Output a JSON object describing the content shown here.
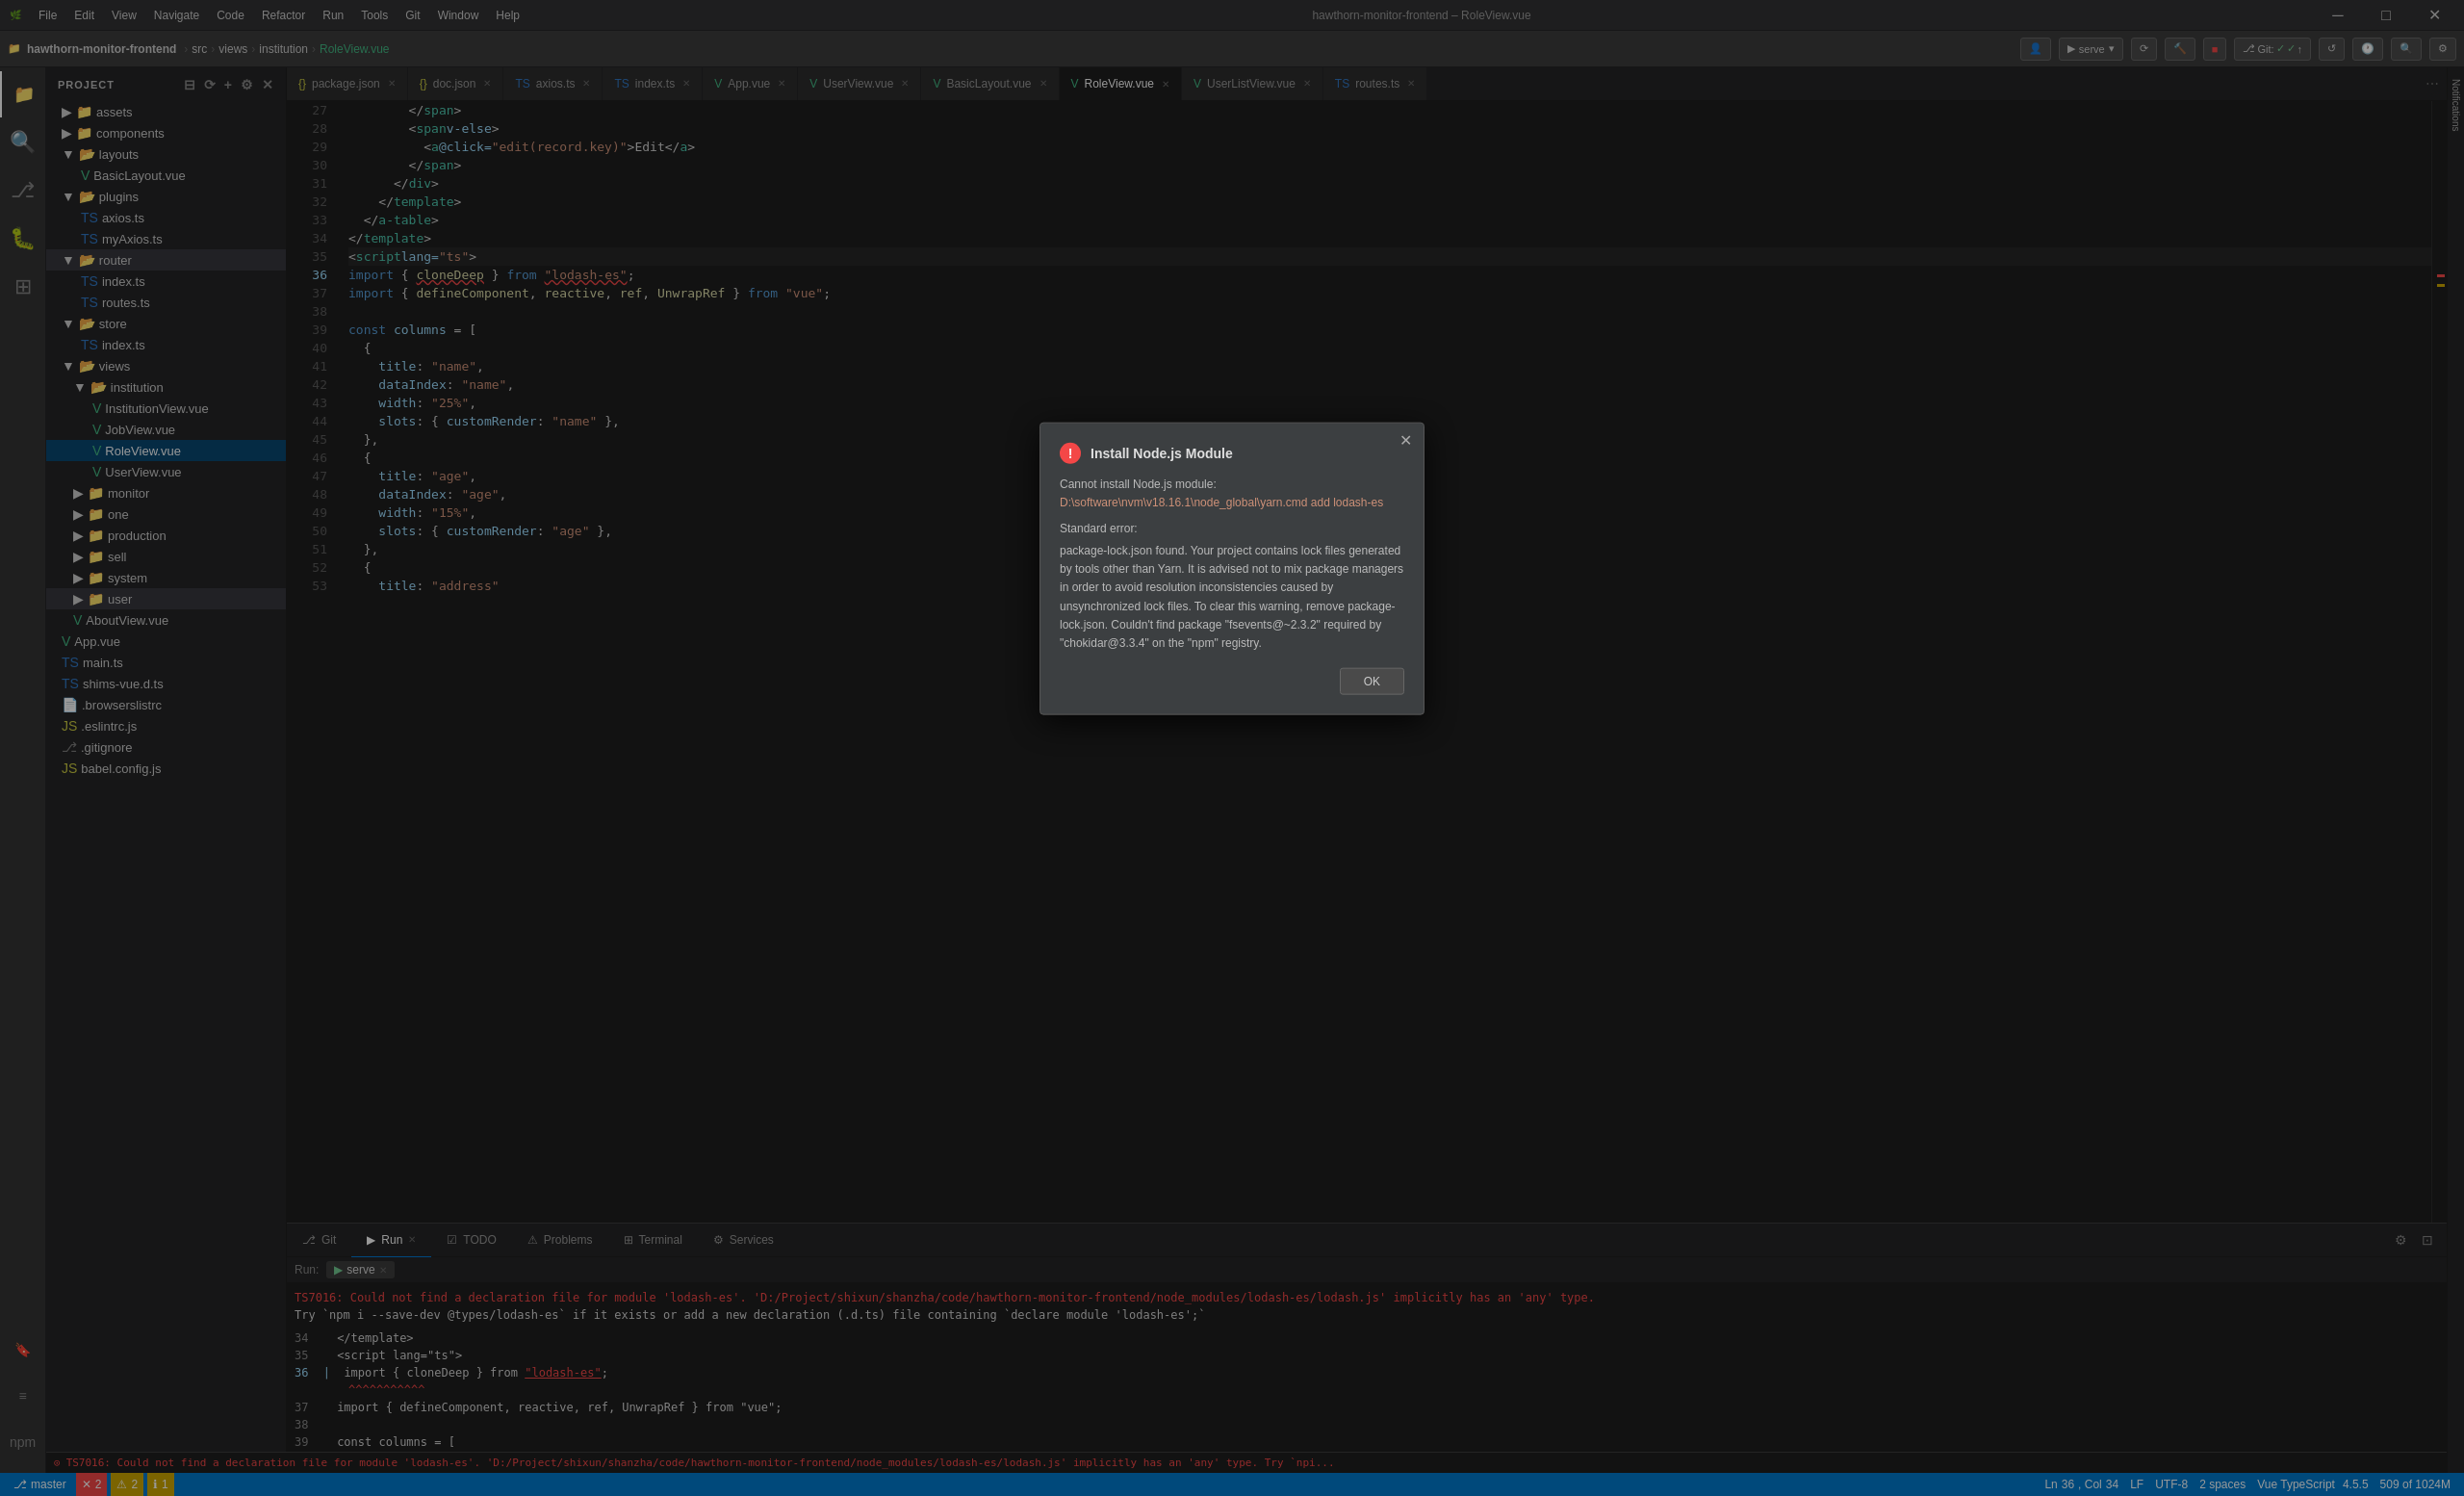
{
  "titleBar": {
    "appName": "hawthorn-monitor-frontend",
    "fileName": "RoleView.vue",
    "title": "hawthorn-monitor-frontend – RoleView.vue",
    "menu": [
      "File",
      "Edit",
      "View",
      "Navigate",
      "Code",
      "Refactor",
      "Run",
      "Tools",
      "Git",
      "Window",
      "Help"
    ]
  },
  "breadcrumb": {
    "items": [
      "hawthorn-monitor-frontend",
      "src",
      "views",
      "institution",
      "RoleView.vue"
    ]
  },
  "toolbar": {
    "profileIcon": "👤",
    "serveLabel": "serve",
    "gitLabel": "Git:",
    "runIcon": "▶"
  },
  "sidebar": {
    "header": "Project",
    "tree": [
      {
        "id": "assets",
        "label": "assets",
        "type": "folder",
        "level": 2
      },
      {
        "id": "components",
        "label": "components",
        "type": "folder",
        "level": 2
      },
      {
        "id": "layouts",
        "label": "layouts",
        "type": "folder",
        "level": 2
      },
      {
        "id": "BasicLayout.vue",
        "label": "BasicLayout.vue",
        "type": "vue",
        "level": 3
      },
      {
        "id": "plugins",
        "label": "plugins",
        "type": "folder",
        "level": 2
      },
      {
        "id": "axios.ts",
        "label": "axios.ts",
        "type": "ts",
        "level": 3
      },
      {
        "id": "myAxios.ts",
        "label": "myAxios.ts",
        "type": "ts",
        "level": 3
      },
      {
        "id": "router",
        "label": "router",
        "type": "folder",
        "level": 2
      },
      {
        "id": "index-router.ts",
        "label": "index.ts",
        "type": "ts",
        "level": 3
      },
      {
        "id": "routes.ts",
        "label": "routes.ts",
        "type": "ts",
        "level": 3
      },
      {
        "id": "store",
        "label": "store",
        "type": "folder",
        "level": 2
      },
      {
        "id": "index-store.ts",
        "label": "index.ts",
        "type": "ts",
        "level": 3
      },
      {
        "id": "views",
        "label": "views",
        "type": "folder",
        "level": 2
      },
      {
        "id": "institution",
        "label": "institution",
        "type": "folder",
        "level": 3
      },
      {
        "id": "InstitutionView.vue",
        "label": "InstitutionView.vue",
        "type": "vue",
        "level": 4
      },
      {
        "id": "JobView.vue",
        "label": "JobView.vue",
        "type": "vue",
        "level": 4
      },
      {
        "id": "RoleView.vue",
        "label": "RoleView.vue",
        "type": "vue",
        "level": 4,
        "active": true
      },
      {
        "id": "UserView.vue-inst",
        "label": "UserView.vue",
        "type": "vue",
        "level": 4
      },
      {
        "id": "monitor",
        "label": "monitor",
        "type": "folder",
        "level": 3
      },
      {
        "id": "one",
        "label": "one",
        "type": "folder",
        "level": 3
      },
      {
        "id": "production",
        "label": "production",
        "type": "folder",
        "level": 3
      },
      {
        "id": "sell",
        "label": "sell",
        "type": "folder",
        "level": 3
      },
      {
        "id": "system",
        "label": "system",
        "type": "folder",
        "level": 3
      },
      {
        "id": "user",
        "label": "user",
        "type": "folder",
        "level": 3
      },
      {
        "id": "AboutView.vue",
        "label": "AboutView.vue",
        "type": "vue",
        "level": 3
      },
      {
        "id": "App.vue",
        "label": "App.vue",
        "type": "vue",
        "level": 2
      },
      {
        "id": "main.ts",
        "label": "main.ts",
        "type": "ts",
        "level": 2
      },
      {
        "id": "shims-vue.d.ts",
        "label": "shims-vue.d.ts",
        "type": "ts",
        "level": 2
      },
      {
        "id": "browserslistrc",
        "label": ".browserslistrc",
        "type": "file",
        "level": 2
      },
      {
        "id": "eslintrc.js",
        "label": ".eslintrc.js",
        "type": "js",
        "level": 2
      },
      {
        "id": "gitignore",
        "label": ".gitignore",
        "type": "git",
        "level": 2
      },
      {
        "id": "babel.config.js",
        "label": "babel.config.js",
        "type": "js",
        "level": 2
      }
    ]
  },
  "tabs": [
    {
      "id": "package.json",
      "label": "package.json",
      "type": "json",
      "modified": false
    },
    {
      "id": "doc.json",
      "label": "doc.json",
      "type": "json",
      "modified": false
    },
    {
      "id": "axios.ts",
      "label": "axios.ts",
      "type": "ts",
      "modified": false
    },
    {
      "id": "index.ts",
      "label": "index.ts",
      "type": "ts",
      "modified": false
    },
    {
      "id": "App.vue",
      "label": "App.vue",
      "type": "vue",
      "modified": false
    },
    {
      "id": "UserView.vue",
      "label": "UserView.vue",
      "type": "vue",
      "modified": false
    },
    {
      "id": "BasicLayout.vue",
      "label": "BasicLayout.vue",
      "type": "vue",
      "modified": false
    },
    {
      "id": "RoleView.vue",
      "label": "RoleView.vue",
      "type": "vue",
      "active": true,
      "modified": false
    },
    {
      "id": "UserListView.vue",
      "label": "UserListView.vue",
      "type": "vue",
      "modified": false
    },
    {
      "id": "routes.ts",
      "label": "routes.ts",
      "type": "ts",
      "modified": false
    }
  ],
  "editor": {
    "lines": [
      {
        "num": 27,
        "code": "        </span>"
      },
      {
        "num": 28,
        "code": "        <span v-else>"
      },
      {
        "num": 29,
        "code": "          <a @click=\"edit(record.key)\">Edit</a>"
      },
      {
        "num": 30,
        "code": "        </span>"
      },
      {
        "num": 31,
        "code": "      </div>"
      },
      {
        "num": 32,
        "code": "    </template>"
      },
      {
        "num": 33,
        "code": "  </a-table>"
      },
      {
        "num": 34,
        "code": "</template>"
      },
      {
        "num": 35,
        "code": "<script lang=\"ts\">"
      },
      {
        "num": 36,
        "code": "import { cloneDeep } from \"lodash-es\";"
      },
      {
        "num": 37,
        "code": "import { defineComponent, reactive, ref, UnwrapRef } from \"vue\";"
      },
      {
        "num": 38,
        "code": ""
      },
      {
        "num": 39,
        "code": "const columns = ["
      },
      {
        "num": 40,
        "code": "  {"
      },
      {
        "num": 41,
        "code": "    title: \"name\","
      },
      {
        "num": 42,
        "code": "    dataIndex: \"name\","
      },
      {
        "num": 43,
        "code": "    width: \"25%\","
      },
      {
        "num": 44,
        "code": "    slots: { customRender: \"name\" },"
      },
      {
        "num": 45,
        "code": "  },"
      },
      {
        "num": 46,
        "code": "  {"
      },
      {
        "num": 47,
        "code": "    title: \"age\","
      },
      {
        "num": 48,
        "code": "    dataIndex: \"age\","
      },
      {
        "num": 49,
        "code": "    width: \"15%\","
      },
      {
        "num": 50,
        "code": "    slots: { customRender: \"age\" },"
      },
      {
        "num": 51,
        "code": "  },"
      },
      {
        "num": 52,
        "code": "  {"
      },
      {
        "num": 53,
        "code": "    title: \"address\""
      }
    ]
  },
  "modal": {
    "title": "Install Node.js Module",
    "errorIcon": "!",
    "body1": "Cannot install Node.js module:",
    "body2": "D:\\software\\nvm\\v18.16.1\\node_global\\yarn.cmd add lodash-es",
    "body3": "",
    "body4": "Standard error:",
    "body5": "package-lock.json found. Your project contains lock files generated by tools other than Yarn. It is advised not to mix package managers in order to avoid resolution inconsistencies caused by unsynchronized lock files. To clear this warning, remove package-lock.json. Couldn't find package \"fsevents@~2.3.2\" required by \"chokidar@3.3.4\" on the \"npm\" registry.",
    "okLabel": "OK"
  },
  "terminal": {
    "runLabel": "Run:",
    "serveLabel": "serve",
    "tabs": [
      {
        "id": "git",
        "label": "Git",
        "icon": "⎇"
      },
      {
        "id": "run",
        "label": "Run",
        "icon": "▶",
        "active": true
      },
      {
        "id": "todo",
        "label": "TODO",
        "icon": "☑"
      },
      {
        "id": "problems",
        "label": "Problems",
        "icon": "⚠"
      },
      {
        "id": "terminal",
        "label": "Terminal",
        "icon": "⊞"
      },
      {
        "id": "services",
        "label": "Services",
        "icon": "⚙"
      }
    ],
    "errorLine1": "TS7016: Could not find a declaration file for module 'lodash-es'. 'D:/Project/shixun/shanzha/code/hawthorn-monitor-frontend/node_modules/lodash-es/lodash.js' implicitly has an 'any' type.",
    "errorLine2": "Try `npm i --save-dev @types/lodash-es` if it exists or add a new declaration (.d.ts) file containing `declare module 'lodash-es';`",
    "codeLines": [
      {
        "num": "34",
        "code": "  </template>"
      },
      {
        "num": "35",
        "code": "  <script lang=\"ts\">"
      },
      {
        "num": "36",
        "code": "  import { cloneDeep } from \"lodash-es\";",
        "hasError": true
      },
      {
        "num": "",
        "code": "                             ^^^^^^^^^^^"
      },
      {
        "num": "37",
        "code": "  import { defineComponent, reactive, ref, UnwrapRef } from \"vue\";"
      },
      {
        "num": "38",
        "code": ""
      },
      {
        "num": "39",
        "code": "  const columns = ["
      }
    ]
  },
  "statusBar": {
    "gitBranch": "master",
    "gitIcon": "⎇",
    "errors": "2",
    "warnings": "2",
    "line": "36",
    "col": "34",
    "encoding": "UTF-8",
    "indentation": "2 spaces",
    "language": "Vue TypeScript",
    "version": "4.5.5",
    "lf": "LF",
    "lineCount": "509 of 1024M"
  }
}
